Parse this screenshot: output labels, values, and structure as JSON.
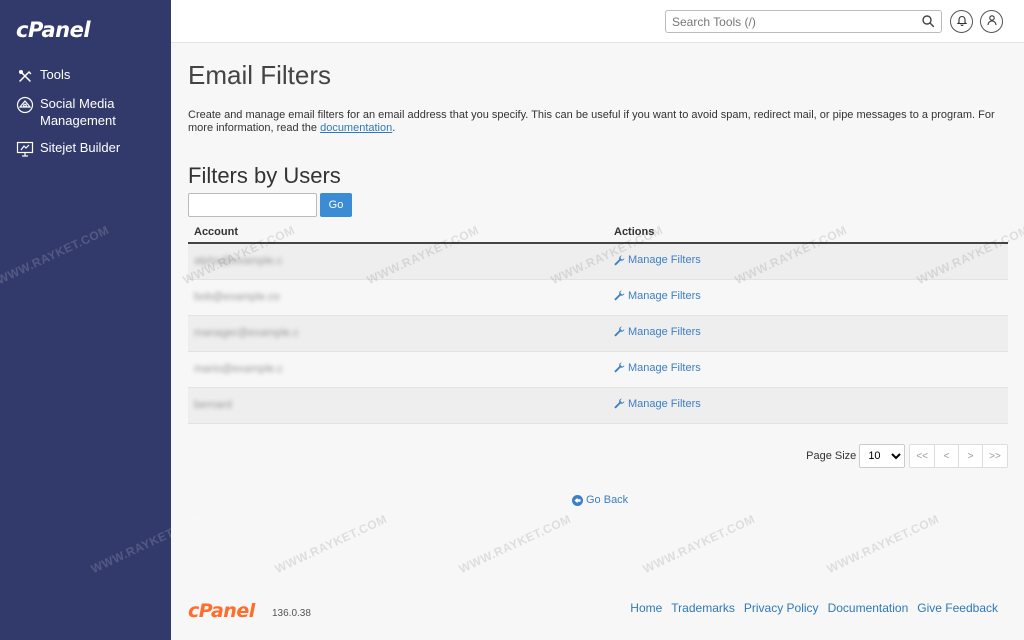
{
  "sidebar": {
    "logo": "cPanel",
    "items": [
      {
        "label": "Tools",
        "icon": "tools-icon"
      },
      {
        "label": "Social Media Management",
        "icon": "social-media-icon"
      },
      {
        "label": "Sitejet Builder",
        "icon": "sitejet-icon"
      }
    ]
  },
  "header": {
    "search_placeholder": "Search Tools (/)",
    "icons": [
      "search-icon",
      "bell-icon",
      "user-icon"
    ]
  },
  "main": {
    "title": "Email Filters",
    "description_before": "Create and manage email filters for an email address that you specify. This can be useful if you want to avoid spam, redirect mail, or pipe messages to a program. For more information, read the ",
    "description_link": "documentation",
    "description_after": ".",
    "section_title": "Filters by Users",
    "filter_value": "",
    "go_label": "Go",
    "table": {
      "columns": [
        "Account",
        "Actions"
      ],
      "rows": [
        {
          "account": "alpha@example.c",
          "action": "Manage Filters"
        },
        {
          "account": "bob@example.co",
          "action": "Manage Filters"
        },
        {
          "account": "manager@example.c",
          "action": "Manage Filters"
        },
        {
          "account": "mario@example.c",
          "action": "Manage Filters"
        },
        {
          "account": "bernard",
          "action": "Manage Filters"
        }
      ]
    },
    "pagination": {
      "label": "Page Size",
      "page_size": "10",
      "buttons": [
        "<<",
        "<",
        ">",
        ">>"
      ]
    },
    "go_back": "Go Back"
  },
  "footer": {
    "logo": "cPanel",
    "version": "136.0.38",
    "links": [
      "Home",
      "Trademarks",
      "Privacy Policy",
      "Documentation",
      "Give Feedback"
    ]
  },
  "watermark": "WWW.RAYKET.COM",
  "colors": {
    "sidebar": "#323a6b",
    "accent": "#3b8bd5",
    "link": "#2f79b9",
    "brand_orange": "#ff6c2c"
  }
}
